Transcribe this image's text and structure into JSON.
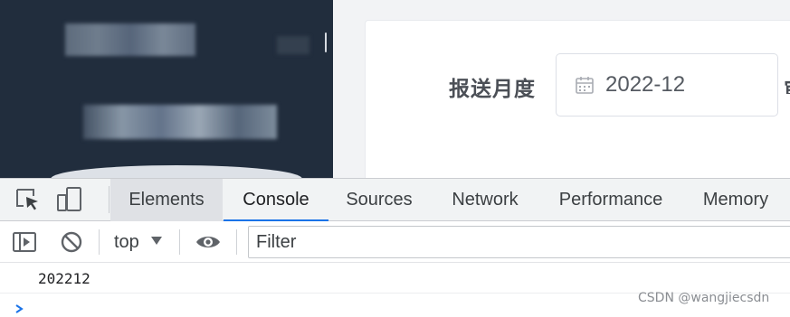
{
  "form": {
    "label": "报送月度",
    "date_value": "2022-12",
    "cut_text": "审"
  },
  "devtools": {
    "tabs": [
      "Elements",
      "Console",
      "Sources",
      "Network",
      "Performance",
      "Memory"
    ],
    "context": "top",
    "filter_placeholder": "Filter",
    "console_output": "202212"
  },
  "watermark": "CSDN @wangjiecsdn",
  "icons": {
    "inspect": "inspect-element-icon",
    "device": "device-toolbar-icon",
    "sidebar": "show-console-sidebar-icon",
    "clear": "clear-console-icon",
    "eye": "live-expression-icon",
    "calendar": "calendar-icon",
    "prompt": "console-prompt-icon"
  },
  "colors": {
    "sidebar_bg": "#212d3d",
    "active_tab_underline": "#1a73e8",
    "prompt_arrow": "#1a73e8"
  }
}
